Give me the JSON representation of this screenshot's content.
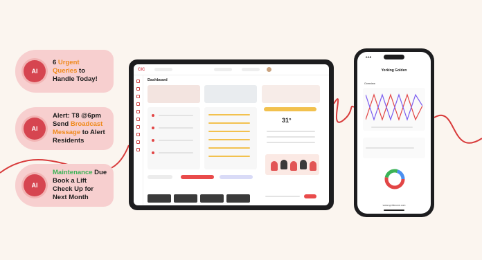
{
  "callouts": [
    {
      "badge": "AI",
      "line1_num": "6",
      "line1_hl": " Urgent",
      "line2": "Queries",
      "line2_rest": " to",
      "line3": "Handle Today!"
    },
    {
      "badge": "AI",
      "line1": "Alert: T8 @6pm",
      "line2": "Send ",
      "line2_hl": "Broadcast",
      "line3_hl": "Message",
      "line3_rest": " to Alert",
      "line4": "Residents"
    },
    {
      "badge": "AI",
      "line1_hl": "Maintenance",
      "line1_rest": " Due",
      "line2": "Book a Lift",
      "line3": "Check Up for",
      "line4": "Next Month"
    }
  ],
  "tablet": {
    "logo": "CIC",
    "section_title": "Dashboard",
    "temperature": "31°"
  },
  "phone": {
    "time": "2:15",
    "title": "Yorking Golden",
    "overview_label": "Overview",
    "footer": "www.sprinkzone.com"
  },
  "colors": {
    "accent": "#d64550",
    "callout_bg": "#f7cfcf",
    "wire": "#d83b3b",
    "highlight_orange": "#ef8a1c",
    "highlight_green": "#3bb356"
  }
}
